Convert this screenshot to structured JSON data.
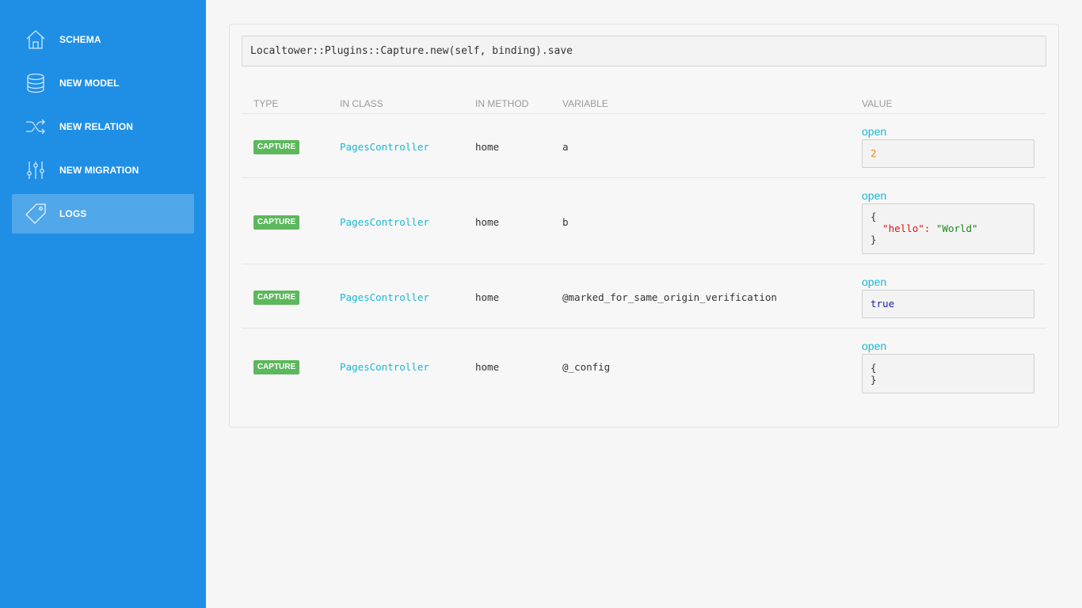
{
  "sidebar": {
    "items": [
      {
        "label": "SCHEMA",
        "icon": "home-icon",
        "active": false
      },
      {
        "label": "NEW MODEL",
        "icon": "database-icon",
        "active": false
      },
      {
        "label": "NEW RELATION",
        "icon": "shuffle-icon",
        "active": false
      },
      {
        "label": "NEW MIGRATION",
        "icon": "sliders-icon",
        "active": false
      },
      {
        "label": "LOGS",
        "icon": "tag-icon",
        "active": true
      }
    ]
  },
  "code_line": "Localtower::Plugins::Capture.new(self, binding).save",
  "table": {
    "headers": [
      "TYPE",
      "IN CLASS",
      "IN METHOD",
      "VARIABLE",
      "VALUE"
    ],
    "open_label": "open",
    "rows": [
      {
        "type": "CAPTURE",
        "in_class": "PagesController",
        "in_method": "home",
        "variable": "a",
        "value": {
          "number": "2"
        }
      },
      {
        "type": "CAPTURE",
        "in_class": "PagesController",
        "in_method": "home",
        "variable": "b",
        "value": {
          "open_brace": "{",
          "key": "\"hello\"",
          "colon": ": ",
          "val": "\"World\"",
          "close_brace": "}"
        }
      },
      {
        "type": "CAPTURE",
        "in_class": "PagesController",
        "in_method": "home",
        "variable": "@marked_for_same_origin_verification",
        "value": {
          "keyword": "true"
        }
      },
      {
        "type": "CAPTURE",
        "in_class": "PagesController",
        "in_method": "home",
        "variable": "@_config",
        "value": {
          "open_brace": "{",
          "close_brace": "}"
        }
      }
    ]
  },
  "colors": {
    "sidebar": "#1f8fe5",
    "badge": "#5cb85c",
    "link": "#1ab7d4",
    "number": "#f08d1a",
    "json_key": "#dd1111",
    "json_string": "#1a8a1a",
    "keyword": "#1a1aa6"
  }
}
